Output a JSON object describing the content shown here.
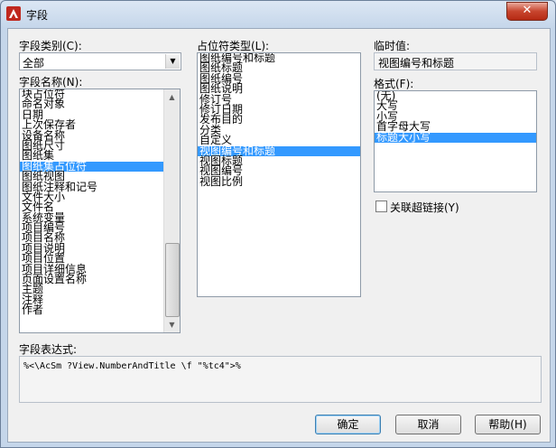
{
  "window": {
    "title": "字段",
    "close_glyph": "✕"
  },
  "category": {
    "label": "字段类别(C):",
    "value": "全部"
  },
  "field_names": {
    "label": "字段名称(N):",
    "items": [
      "块占位符",
      "命名对象",
      "日期",
      "上次保存者",
      "设备名称",
      "图纸尺寸",
      "图纸集",
      "图纸集占位符",
      "图纸视图",
      "图纸注释和记号",
      "文件大小",
      "文件名",
      "系统变量",
      "项目编号",
      "项目名称",
      "项目说明",
      "项目位置",
      "项目详细信息",
      "页面设置名称",
      "主题",
      "注释",
      "作者"
    ],
    "selected_index": 7
  },
  "placeholder_types": {
    "label": "占位符类型(L):",
    "items": [
      "图纸编号和标题",
      "图纸标题",
      "图纸编号",
      "图纸说明",
      "修订号",
      "修订日期",
      "发布目的",
      "分类",
      "自定义",
      "视图编号和标题",
      "视图标题",
      "视图编号",
      "视图比例"
    ],
    "selected_index": 9
  },
  "temp_value": {
    "label": "临时值:",
    "value": "视图编号和标题"
  },
  "format": {
    "label": "格式(F):",
    "items": [
      "(无)",
      "大写",
      "小写",
      "首字母大写",
      "标题大小写"
    ],
    "selected_index": 4
  },
  "hyperlink": {
    "label": "关联超链接(Y)",
    "checked": false
  },
  "expression": {
    "label": "字段表达式:",
    "value": "%<\\AcSm ?View.NumberAndTitle \\f \"%tc4\">%"
  },
  "buttons": {
    "ok": "确定",
    "cancel": "取消",
    "help": "帮助(H)"
  },
  "colors": {
    "selection": "#3399ff",
    "close_button": "#c8452e"
  }
}
